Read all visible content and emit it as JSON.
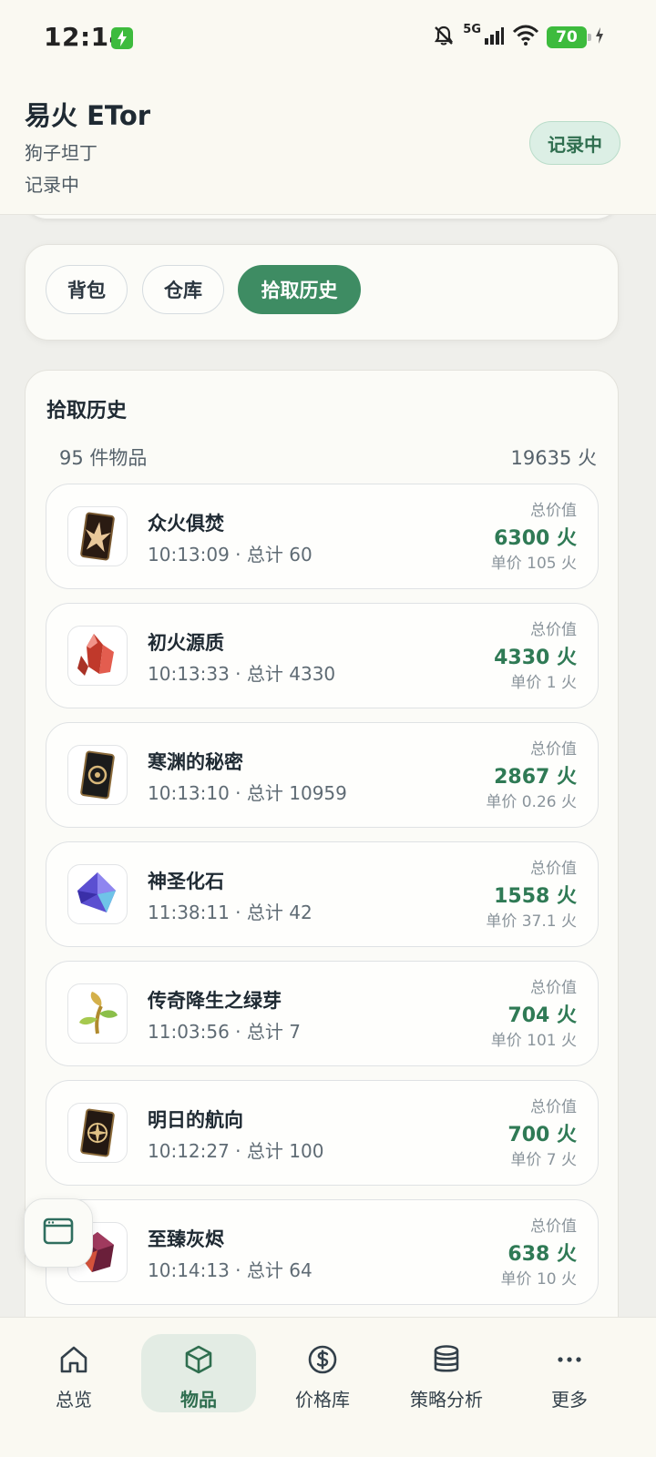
{
  "status_bar": {
    "time": "12:14",
    "network": "5G",
    "battery": "70"
  },
  "header": {
    "title": "易火 ETor",
    "subtitle": "狗子坦丁",
    "status_text": "记录中",
    "chip_label": "记录中"
  },
  "tabs": [
    {
      "label": "背包",
      "active": false
    },
    {
      "label": "仓库",
      "active": false
    },
    {
      "label": "拾取历史",
      "active": true
    }
  ],
  "history": {
    "title": "拾取历史",
    "count": "95 件物品",
    "total": "19635 火",
    "items": [
      {
        "name": "众火俱焚",
        "meta": "10:13:09 · 总计 60",
        "label": "总价值",
        "total": "6300 火",
        "unit": "单价 105 火",
        "icon": "flame-card-icon"
      },
      {
        "name": "初火源质",
        "meta": "10:13:33 · 总计 4330",
        "label": "总价值",
        "total": "4330 火",
        "unit": "单价 1 火",
        "icon": "red-crystal-icon"
      },
      {
        "name": "寒渊的秘密",
        "meta": "10:13:10 · 总计 10959",
        "label": "总价值",
        "total": "2867 火",
        "unit": "单价 0.26 火",
        "icon": "abyss-card-icon"
      },
      {
        "name": "神圣化石",
        "meta": "11:38:11 · 总计 42",
        "label": "总价值",
        "total": "1558 火",
        "unit": "单价 37.1 火",
        "icon": "blue-crystal-icon"
      },
      {
        "name": "传奇降生之绿芽",
        "meta": "11:03:56 · 总计 7",
        "label": "总价值",
        "total": "704 火",
        "unit": "单价 101 火",
        "icon": "sprout-icon"
      },
      {
        "name": "明日的航向",
        "meta": "10:12:27 · 总计 100",
        "label": "总价值",
        "total": "700 火",
        "unit": "单价 7 火",
        "icon": "compass-card-icon"
      },
      {
        "name": "至臻灰烬",
        "meta": "10:14:13 · 总计 64",
        "label": "总价值",
        "total": "638 火",
        "unit": "单价 10 火",
        "icon": "ember-gem-icon"
      }
    ]
  },
  "bottom_nav": [
    {
      "label": "总览",
      "icon": "home-icon",
      "active": false
    },
    {
      "label": "物品",
      "icon": "box-icon",
      "active": true
    },
    {
      "label": "价格库",
      "icon": "dollar-icon",
      "active": false
    },
    {
      "label": "策略分析",
      "icon": "database-icon",
      "active": false
    },
    {
      "label": "更多",
      "icon": "more-icon",
      "active": false
    }
  ],
  "colors": {
    "accent": "#3e8c63",
    "value_green": "#2f7a55",
    "background": "#efefeb",
    "header_bg": "#faf9f2"
  }
}
